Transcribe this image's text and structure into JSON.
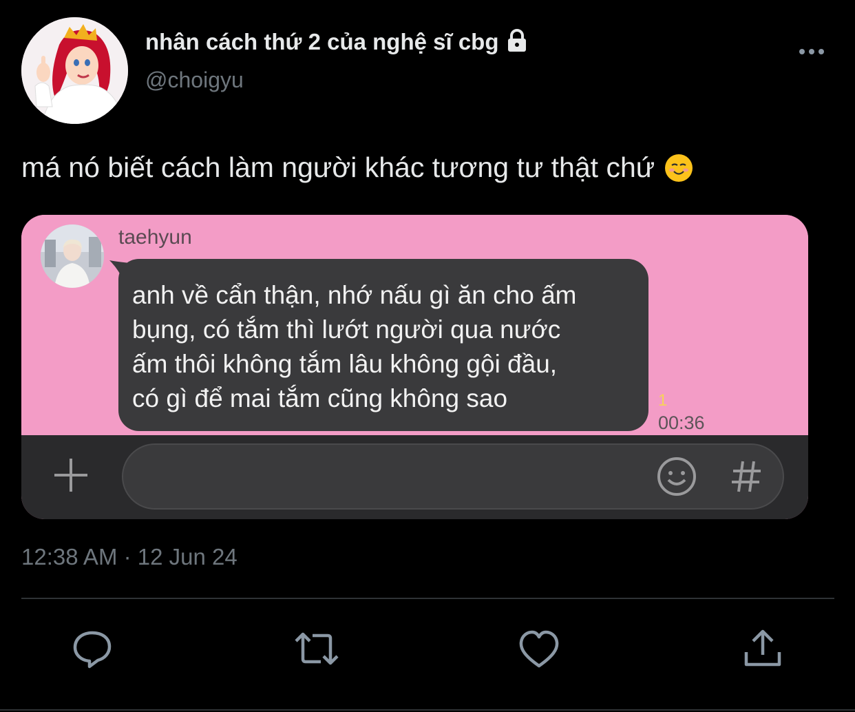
{
  "user": {
    "display_name": "nhân cách thứ 2 của nghệ sĩ cbg",
    "handle": "@choigyu"
  },
  "tweet": {
    "text": "má nó biết cách làm người khác tương tư thật chứ",
    "emoji": "smiling-face-icon",
    "timestamp": "12:38 AM · 12 Jun 24"
  },
  "embedded_chat": {
    "sender": "taehyun",
    "message_lines": [
      "anh về cẩn thận, nhớ nấu gì ăn cho ấm",
      "bụng, có tắm thì lướt người qua nước",
      "ấm thôi không tắm lâu không gội đầu,",
      "có gì để mai tắm cũng không sao"
    ],
    "unread_count": "1",
    "time": "00:36",
    "background_color": "#f39cc6",
    "bubble_color": "#3a3a3c"
  },
  "actions": {
    "reply": "reply-icon",
    "retweet": "retweet-icon",
    "like": "heart-icon",
    "share": "share-icon"
  },
  "colors": {
    "background": "#000000",
    "text": "#e7e9ea",
    "secondary_text": "#6e767d"
  }
}
